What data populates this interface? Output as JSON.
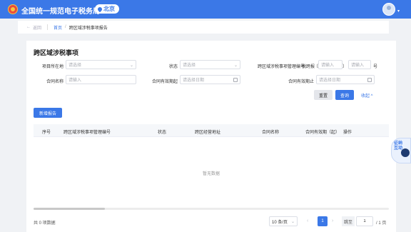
{
  "header": {
    "brand": "全国统一规范电子税务局",
    "region": "北京"
  },
  "breadcrumb": {
    "back": "返回",
    "home": "首页",
    "separator": "/",
    "current": "跨区域涉税事项报告"
  },
  "page": {
    "title": "跨区域涉税事项"
  },
  "filters": {
    "location_label": "项目所在地",
    "location_placeholder": "请选择",
    "status_label": "状态",
    "status_placeholder": "请选择",
    "mgmt_no_label": "跨区域涉税事项管理编号",
    "mgmt_no_prefix": "税跨报",
    "bracket_open": "〔",
    "bracket_close": "〕",
    "mgmt_no_suffix": "号",
    "mgmt_no_placeholder_1": "请输入",
    "mgmt_no_placeholder_2": "请输入",
    "contract_name_label": "合同名称",
    "contract_name_placeholder": "请输入",
    "valid_from_label": "合同有效期起",
    "valid_from_placeholder": "请选择日期",
    "valid_to_label": "合同有效期止",
    "valid_to_placeholder": "请选择日期",
    "reset_label": "重置",
    "search_label": "查询",
    "collapse_label": "收起 ^"
  },
  "actions": {
    "new_report": "新增报告"
  },
  "table": {
    "columns": [
      "序号",
      "跨区域涉税事项管理编号",
      "状态",
      "跨区经营地址",
      "合同名称",
      "合同有效期（起）",
      "操作"
    ],
    "empty_text": "暂无数据"
  },
  "pagination": {
    "total": "共 0 项数据",
    "page_size": "10 条/页",
    "current_page": "1",
    "goto_label": "跳至",
    "goto_value": "1",
    "total_pages": "/ 1 页",
    "prev": "‹",
    "next": "›"
  },
  "assistant": {
    "label": "征纳互动"
  },
  "colors": {
    "primary": "#3b78e7",
    "header": "#3b78e7",
    "logo": "#e94b3c"
  }
}
